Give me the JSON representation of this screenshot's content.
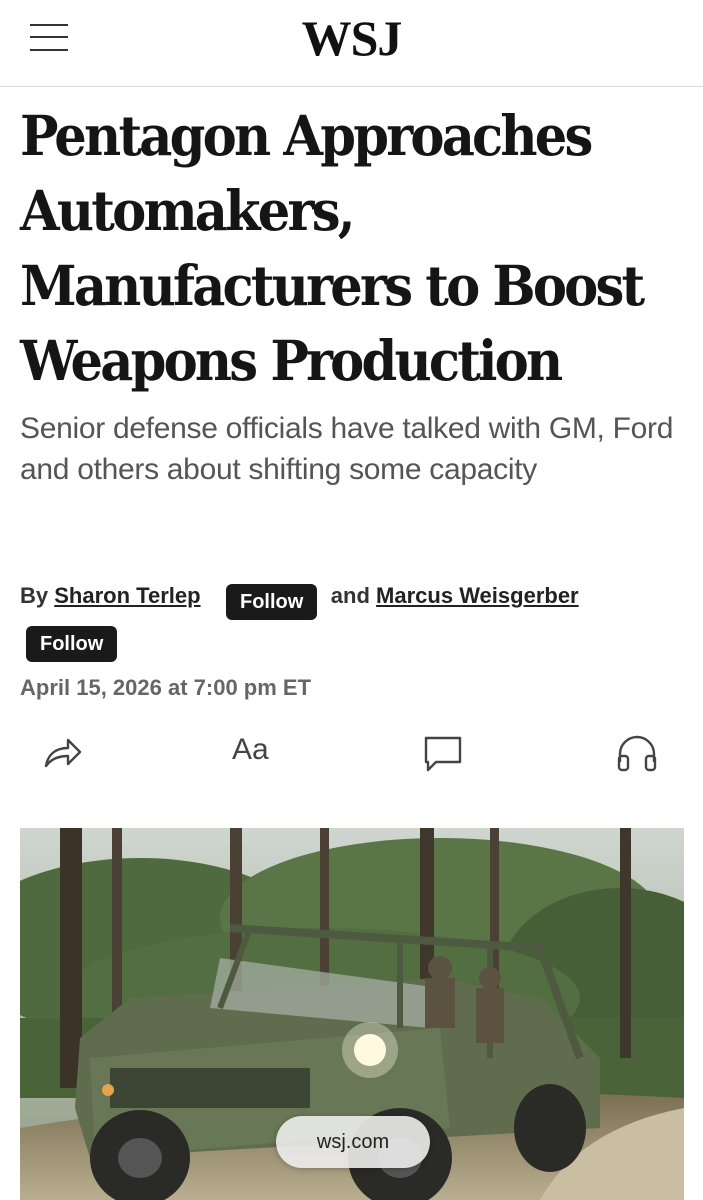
{
  "header": {
    "logo": "WSJ",
    "menu_icon": "hamburger-menu-icon"
  },
  "article": {
    "headline": "Pentagon Approaches Automakers, Manufacturers to Boost Weapons Production",
    "dek": "Senior defense officials have talked with GM, Ford and others about shifting some capacity",
    "byline": {
      "prefix": "By",
      "author1": "Sharon Terlep",
      "follow1": "Follow",
      "conjunction": "and",
      "author2": "Marcus Weisgerber",
      "follow2": "Follow"
    },
    "date": "April 15, 2026 at 7:00 pm ET"
  },
  "toolbar": {
    "share_icon": "share-arrow-icon",
    "text_size_label": "Aa",
    "comment_icon": "comment-icon",
    "listen_icon": "headphones-icon"
  },
  "hero_image": {
    "subject": "military utility vehicle in pine forest"
  },
  "browser": {
    "url_pill": "wsj.com"
  },
  "colors": {
    "follow_bg": "#1a1a1a",
    "text": "#111111",
    "dek": "#555555",
    "date": "#666666"
  }
}
